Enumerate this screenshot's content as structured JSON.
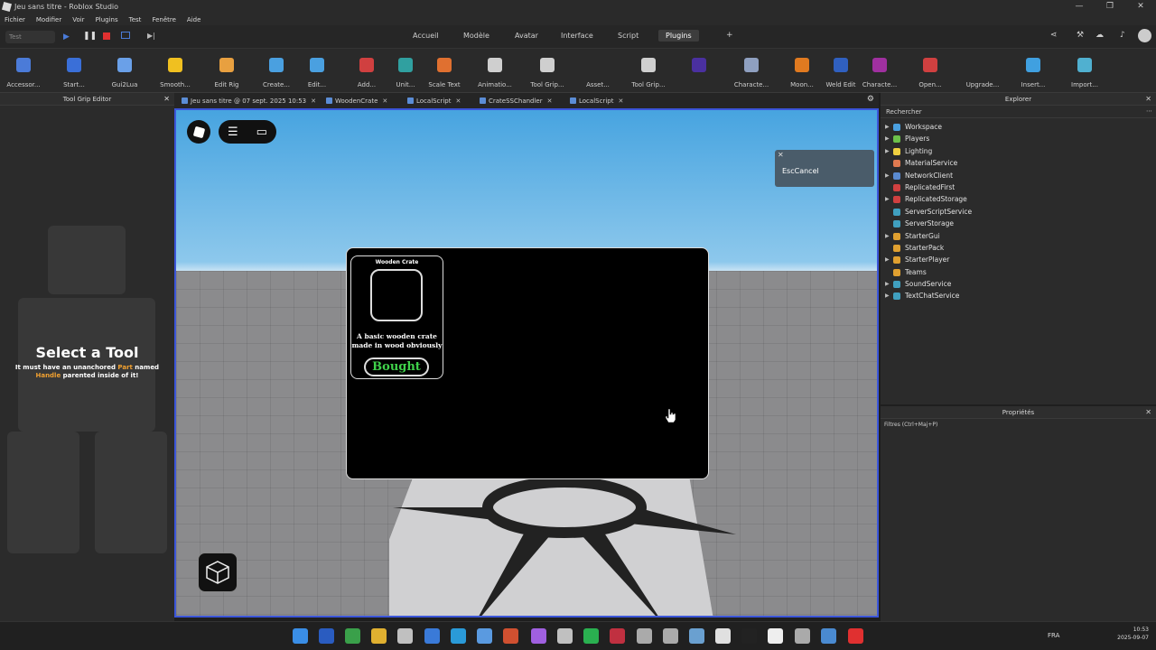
{
  "window": {
    "title": "Jeu sans titre - Roblox Studio",
    "controls": [
      "—",
      "❐",
      "✕"
    ]
  },
  "menu": [
    "Fichier",
    "Modifier",
    "Voir",
    "Plugins",
    "Test",
    "Fenêtre",
    "Aide"
  ],
  "playmode": {
    "selected": "Test"
  },
  "ribbon_tabs": [
    "Accueil",
    "Modèle",
    "Avatar",
    "Interface",
    "Script",
    "Plugins"
  ],
  "ribbon_active": "Plugins",
  "tools": [
    {
      "label": "Accessor...",
      "color": "#4b7bd8"
    },
    {
      "label": "Start...",
      "color": "#3a6fd8"
    },
    {
      "label": "Gui2Lua",
      "color": "#6aa0e8"
    },
    {
      "label": "Smooth...",
      "color": "#f0c020"
    },
    {
      "label": "Edit Rig",
      "color": "#e8a040"
    },
    {
      "label": "Create...",
      "color": "#4aa0e0"
    },
    {
      "label": "Edit...",
      "color": "#4aa0e0"
    },
    {
      "label": "Add...",
      "color": "#d04040"
    },
    {
      "label": "Unit...",
      "color": "#30a0a0"
    },
    {
      "label": "Scale Text",
      "color": "#e07030"
    },
    {
      "label": "Animatio...",
      "color": "#cfcfcf"
    },
    {
      "label": "Tool Grip...",
      "color": "#cfcfcf"
    },
    {
      "label": "Asset...",
      "color": "#2a2a2a"
    },
    {
      "label": "Tool Grip...",
      "color": "#cfcfcf"
    },
    {
      "label": "",
      "color": "#4a30a0"
    },
    {
      "label": "Characte...",
      "color": "#8fa0c0"
    },
    {
      "label": "Moon...",
      "color": "#e07a20"
    },
    {
      "label": "Weld Edit",
      "color": "#3060c0"
    },
    {
      "label": "Characte...",
      "color": "#a030a0"
    },
    {
      "label": "Open...",
      "color": "#d04040"
    },
    {
      "label": "Upgrade...",
      "color": "#2a2a2a"
    },
    {
      "label": "Insert...",
      "color": "#40a0e0"
    },
    {
      "label": "Import...",
      "color": "#50b0d0"
    }
  ],
  "left_panel": {
    "title": "Tool Grip Editor",
    "heading": "Select a Tool",
    "desc_a": "It must have an unanchored ",
    "desc_part": "Part",
    "desc_b": " named ",
    "desc_handle": "Handle",
    "desc_c": " parented inside of it!"
  },
  "doc_tabs": [
    {
      "label": "Jeu sans titre @ 07 sept. 2025 10:53"
    },
    {
      "label": "WoodenCrate"
    },
    {
      "label": "LocalScript"
    },
    {
      "label": "CrateSSChandler"
    },
    {
      "label": "LocalScript"
    }
  ],
  "viewport": {
    "esc_label": "EscCancel",
    "shop": {
      "item_name": "Wooden Crate",
      "item_desc": "A basic wooden crate made in wood obviously",
      "button_label": "Bought",
      "button_color": "#3fd24a"
    }
  },
  "explorer": {
    "title": "Explorer",
    "search_placeholder": "Rechercher",
    "items": [
      {
        "label": "Workspace",
        "expand": true,
        "color": "#4aa0e0"
      },
      {
        "label": "Players",
        "expand": true,
        "color": "#6cc04a"
      },
      {
        "label": "Lighting",
        "expand": true,
        "color": "#f0d040"
      },
      {
        "label": "MaterialService",
        "expand": false,
        "color": "#e07a50"
      },
      {
        "label": "NetworkClient",
        "expand": true,
        "color": "#5a8ad0"
      },
      {
        "label": "ReplicatedFirst",
        "expand": false,
        "color": "#d04040"
      },
      {
        "label": "ReplicatedStorage",
        "expand": true,
        "color": "#d04040"
      },
      {
        "label": "ServerScriptService",
        "expand": false,
        "color": "#40a0c0"
      },
      {
        "label": "ServerStorage",
        "expand": false,
        "color": "#40a0c0"
      },
      {
        "label": "StarterGui",
        "expand": true,
        "color": "#e0a030"
      },
      {
        "label": "StarterPack",
        "expand": false,
        "color": "#e0a030"
      },
      {
        "label": "StarterPlayer",
        "expand": true,
        "color": "#e0a030"
      },
      {
        "label": "Teams",
        "expand": false,
        "color": "#e0a030"
      },
      {
        "label": "SoundService",
        "expand": true,
        "color": "#40a0c0"
      },
      {
        "label": "TextChatService",
        "expand": true,
        "color": "#40a0c0"
      }
    ]
  },
  "properties": {
    "title": "Propriétés",
    "filter_placeholder": "Filtres (Ctrl+Maj+P)"
  },
  "taskbar": {
    "tray_lang": "FRA",
    "time": "10:53",
    "date": "2025-09-07"
  }
}
